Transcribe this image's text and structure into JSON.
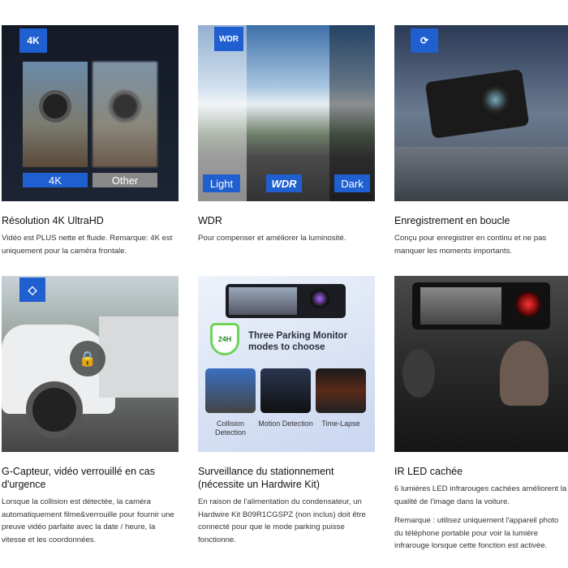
{
  "features": [
    {
      "title": "Résolution 4K UltraHD",
      "body": [
        "Vidéo est PLUS nette et fluide. Remarque: 4K est uniquement pour la caméra frontale."
      ],
      "badge": "4K",
      "labels": [
        "4K",
        "Other"
      ]
    },
    {
      "title": "WDR",
      "body": [
        "Pour compenser et améliorer la luminosité."
      ],
      "badge": "WDR",
      "labels": [
        "Light",
        "WDR",
        "Dark"
      ]
    },
    {
      "title": "Enregistrement en boucle",
      "body": [
        "Conçu pour enregistrer en continu et ne pas manquer les moments importants."
      ],
      "badge_icon": "loop-icon"
    },
    {
      "title": "G-Capteur, vidéo verrouillé en cas d'urgence",
      "body": [
        "Lorsque la collision est détectée, la caméra automatiquement filme&verrouille pour fournir une preuve vidéo parfaite avec la date / heure, la vitesse et les coordonnées."
      ],
      "badge_icon": "g-sensor-icon"
    },
    {
      "title": "Surveillance du stationnement (nécessite un Hardwire Kit)",
      "body": [
        "En raison de l'alimentation du condensateur, un Hardwire Kit B09R1CGSPZ (non inclus) doit être connecté pour que le mode parking puisse fonctionne."
      ],
      "shield": "24H",
      "headline": "Three Parking Monitor modes to choose",
      "modes": [
        "Collision Detection",
        "Motion Detection",
        "Time-Lapse"
      ]
    },
    {
      "title": "IR LED cachée",
      "body": [
        "6 lumières LED infrarouges cachées améliorent la qualité de l'image dans la voiture.",
        "Remarque : utilisez uniquement l'appareil photo du téléphone portable pour voir la lumière infrarouge lorsque cette fonction est activée."
      ]
    }
  ],
  "colors": {
    "accent": "#1f5fd0"
  }
}
